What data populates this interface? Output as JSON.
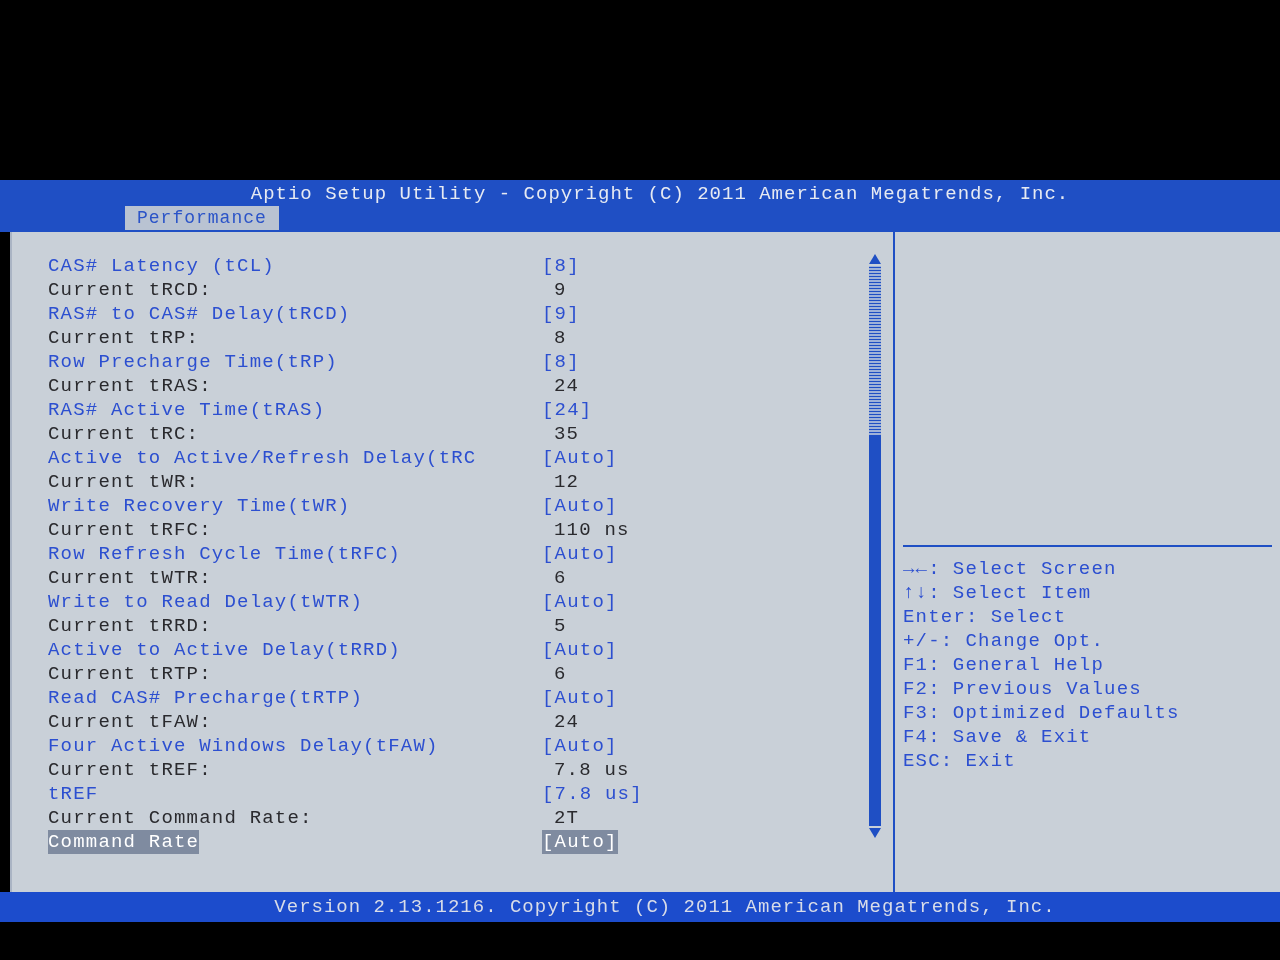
{
  "header": {
    "title": "Aptio Setup Utility - Copyright (C) 2011 American Megatrends, Inc.",
    "tabs": [
      {
        "label": "Performance",
        "selected": true
      }
    ]
  },
  "settings": [
    {
      "kind": "setting",
      "label": "CAS# Latency (tCL)",
      "value": "[8]",
      "selected": false
    },
    {
      "kind": "info",
      "label": "Current tRCD:",
      "value": "9",
      "selected": false
    },
    {
      "kind": "setting",
      "label": "RAS# to CAS# Delay(tRCD)",
      "value": "[9]",
      "selected": false
    },
    {
      "kind": "info",
      "label": "Current tRP:",
      "value": "8",
      "selected": false
    },
    {
      "kind": "setting",
      "label": "Row Precharge Time(tRP)",
      "value": "[8]",
      "selected": false
    },
    {
      "kind": "info",
      "label": "Current tRAS:",
      "value": "24",
      "selected": false
    },
    {
      "kind": "setting",
      "label": "RAS# Active Time(tRAS)",
      "value": "[24]",
      "selected": false
    },
    {
      "kind": "info",
      "label": "Current tRC:",
      "value": "35",
      "selected": false
    },
    {
      "kind": "setting",
      "label": "Active to Active/Refresh Delay(tRC",
      "value": "[Auto]",
      "selected": false
    },
    {
      "kind": "info",
      "label": "Current tWR:",
      "value": "12",
      "selected": false
    },
    {
      "kind": "setting",
      "label": "Write Recovery Time(tWR)",
      "value": "[Auto]",
      "selected": false
    },
    {
      "kind": "info",
      "label": "Current tRFC:",
      "value": "110 ns",
      "selected": false
    },
    {
      "kind": "setting",
      "label": "Row Refresh Cycle Time(tRFC)",
      "value": "[Auto]",
      "selected": false
    },
    {
      "kind": "info",
      "label": "Current tWTR:",
      "value": "6",
      "selected": false
    },
    {
      "kind": "setting",
      "label": "Write to Read Delay(tWTR)",
      "value": "[Auto]",
      "selected": false
    },
    {
      "kind": "info",
      "label": "Current tRRD:",
      "value": "5",
      "selected": false
    },
    {
      "kind": "setting",
      "label": "Active to Active Delay(tRRD)",
      "value": "[Auto]",
      "selected": false
    },
    {
      "kind": "info",
      "label": "Current tRTP:",
      "value": "6",
      "selected": false
    },
    {
      "kind": "setting",
      "label": "Read CAS# Precharge(tRTP)",
      "value": "[Auto]",
      "selected": false
    },
    {
      "kind": "info",
      "label": "Current tFAW:",
      "value": "24",
      "selected": false
    },
    {
      "kind": "setting",
      "label": "Four Active Windows Delay(tFAW)",
      "value": "[Auto]",
      "selected": false
    },
    {
      "kind": "info",
      "label": "Current tREF:",
      "value": "7.8 us",
      "selected": false
    },
    {
      "kind": "setting",
      "label": "tREF",
      "value": "[7.8 us]",
      "selected": false
    },
    {
      "kind": "info",
      "label": "Current Command Rate:",
      "value": "2T",
      "selected": false
    },
    {
      "kind": "setting",
      "label": "Command Rate",
      "value": "[Auto]",
      "selected": true
    }
  ],
  "help": [
    {
      "key": "→←:",
      "action": "Select Screen"
    },
    {
      "key": "↑↓:",
      "action": "Select Item"
    },
    {
      "key": "Enter:",
      "action": "Select"
    },
    {
      "key": "+/-:",
      "action": "Change Opt."
    },
    {
      "key": "F1:",
      "action": "General Help"
    },
    {
      "key": "F2:",
      "action": "Previous Values"
    },
    {
      "key": "F3:",
      "action": "Optimized Defaults"
    },
    {
      "key": "F4:",
      "action": "Save & Exit"
    },
    {
      "key": "ESC:",
      "action": "Exit"
    }
  ],
  "footer": "Version 2.13.1216. Copyright (C) 2011 American Megatrends, Inc."
}
